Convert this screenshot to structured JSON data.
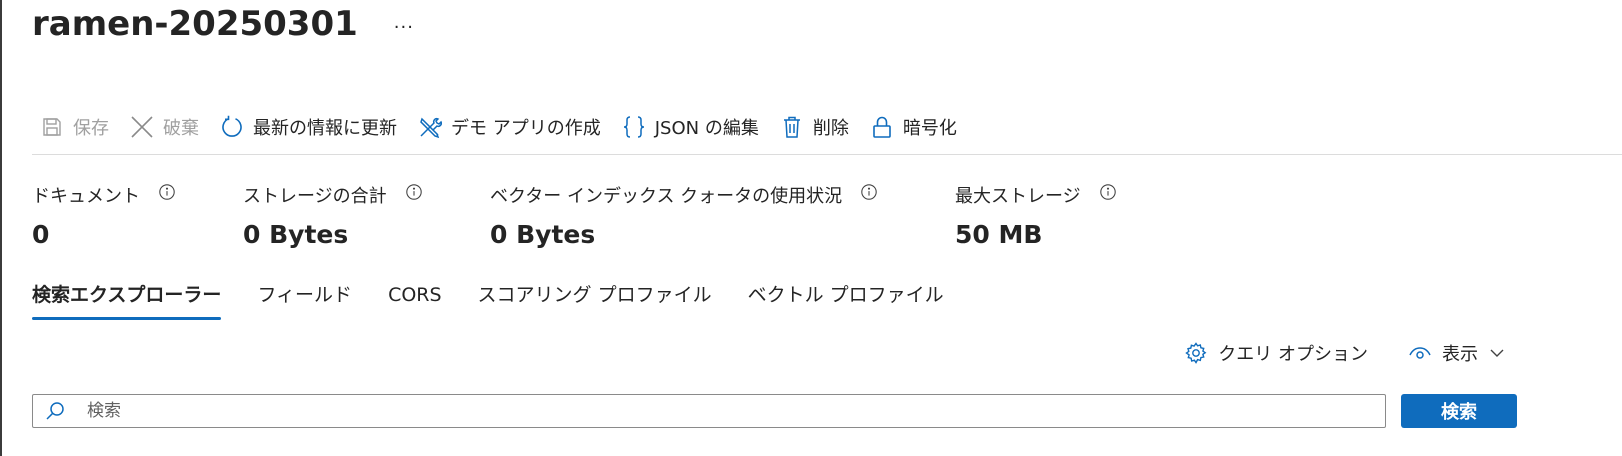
{
  "header": {
    "title": "ramen-20250301",
    "more_label": "···"
  },
  "toolbar": {
    "save_label": "保存",
    "discard_label": "破棄",
    "refresh_label": "最新の情報に更新",
    "demo_app_label": "デモ アプリの作成",
    "edit_json_label": "JSON の編集",
    "delete_label": "削除",
    "encrypt_label": "暗号化"
  },
  "stats": [
    {
      "label": "ドキュメント",
      "value": "0"
    },
    {
      "label": "ストレージの合計",
      "value": "0 Bytes"
    },
    {
      "label": "ベクター インデックス クォータの使用状況",
      "value": "0 Bytes"
    },
    {
      "label": "最大ストレージ",
      "value": "50 MB"
    }
  ],
  "tabs": [
    {
      "label": "検索エクスプローラー",
      "active": true
    },
    {
      "label": "フィールド",
      "active": false
    },
    {
      "label": "CORS",
      "active": false
    },
    {
      "label": "スコアリング プロファイル",
      "active": false
    },
    {
      "label": "ベクトル プロファイル",
      "active": false
    }
  ],
  "options": {
    "query_options_label": "クエリ オプション",
    "view_label": "表示"
  },
  "search": {
    "placeholder": "検索",
    "button_label": "検索"
  },
  "colors": {
    "accent": "#0f6cbd",
    "icon_blue": "#0f6cbd",
    "disabled": "#a0a0a0"
  },
  "icons": {
    "save": "save-icon",
    "discard": "close-icon",
    "refresh": "refresh-icon",
    "demo_app": "wrench-pencil-icon",
    "edit_json": "braces-icon",
    "delete": "trash-icon",
    "encrypt": "lock-icon",
    "info": "info-icon",
    "query_options": "gear-icon",
    "view": "eye-icon",
    "chevron": "chevron-down-icon",
    "search": "search-icon"
  }
}
